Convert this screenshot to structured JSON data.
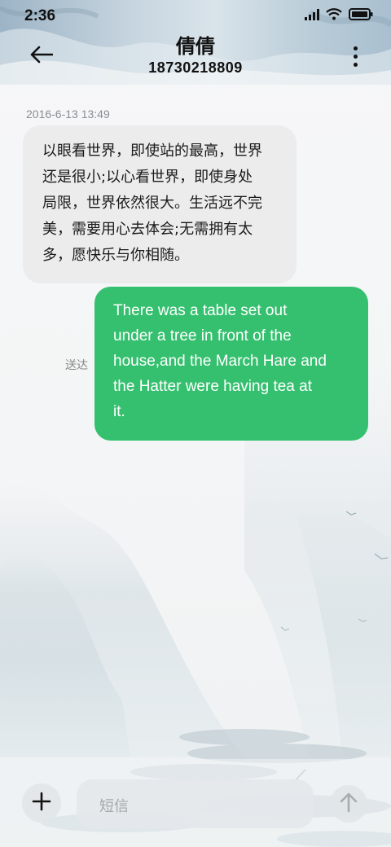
{
  "status_bar": {
    "time": "2:36",
    "icons": [
      "signal-icon",
      "wifi-icon",
      "battery-icon"
    ]
  },
  "header": {
    "contact_name": "倩倩",
    "contact_number": "18730218809",
    "back_icon": "back-arrow-icon",
    "more_icon": "more-vertical-icon"
  },
  "messages": {
    "timestamp": "2016-6-13 13:49",
    "incoming": {
      "lines": [
        "以眼看世界，即使站的最高，世界",
        "还是很小;以心看世界，即使身处",
        "局限，世界依然很大。生活远不完",
        "美，需要用心去体会;无需拥有太",
        "多，愿快乐与你相随。"
      ]
    },
    "outgoing": {
      "lines": [
        "There was a table set out",
        "under a tree in front of the",
        "house,and the March Hare and",
        "the Hatter were having tea at",
        "it."
      ],
      "status": "送达"
    }
  },
  "composer": {
    "placeholder": "短信",
    "plus_icon": "plus-icon",
    "send_icon": "send-arrow-icon"
  },
  "colors": {
    "outgoing_bubble": "#35c06f",
    "incoming_bubble": "#ececec",
    "header_tint": "#c8d6e0"
  }
}
